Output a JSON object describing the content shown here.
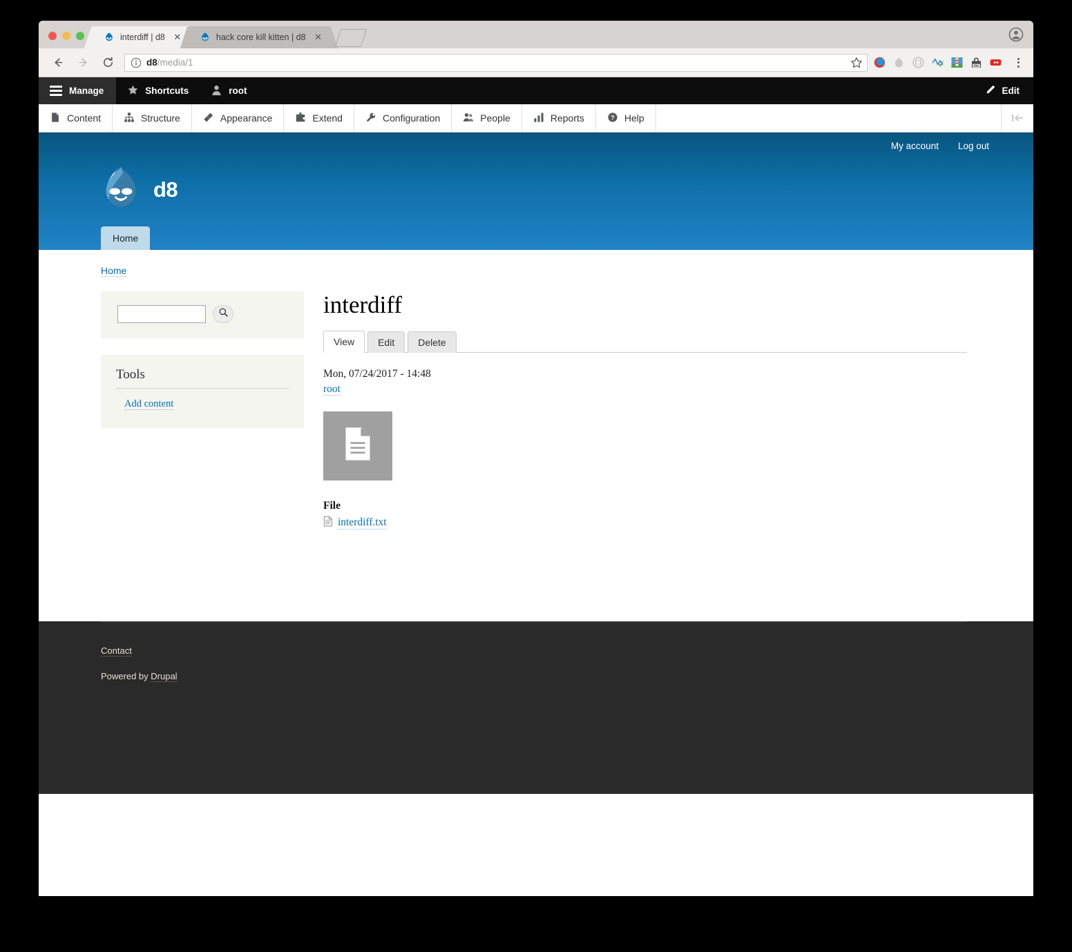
{
  "browser": {
    "tabs": [
      {
        "title": "interdiff | d8",
        "favicon": "drupal-favicon",
        "active": true,
        "close_label": "✕"
      },
      {
        "title": "hack core kill kitten | d8",
        "favicon": "drupal-favicon",
        "active": false,
        "close_label": "✕"
      }
    ],
    "new_tab_label": "",
    "nav": {
      "back": "←",
      "forward": "→",
      "reload": "⟳"
    },
    "url": {
      "host": "d8",
      "path": "/media/1",
      "full": "d8/media/1"
    },
    "extensions": [
      "drupal-dev-icon",
      "drupal-gray-icon",
      "parens-icon",
      "zigzag-check-icon",
      "lighthouse-icon",
      "bag-9m-icon",
      "video-play-icon"
    ],
    "bag_badge": "9m"
  },
  "admin_toolbar": {
    "manage": "Manage",
    "shortcuts": "Shortcuts",
    "user": "root",
    "edit": "Edit",
    "menu": [
      {
        "label": "Content",
        "icon": "content-icon"
      },
      {
        "label": "Structure",
        "icon": "structure-icon"
      },
      {
        "label": "Appearance",
        "icon": "appearance-icon"
      },
      {
        "label": "Extend",
        "icon": "extend-icon"
      },
      {
        "label": "Configuration",
        "icon": "configuration-icon"
      },
      {
        "label": "People",
        "icon": "people-icon"
      },
      {
        "label": "Reports",
        "icon": "reports-icon"
      },
      {
        "label": "Help",
        "icon": "help-icon"
      }
    ]
  },
  "site_header": {
    "site_name": "d8",
    "logo": "drupal-droplet-logo",
    "account_links": [
      {
        "label": "My account"
      },
      {
        "label": "Log out"
      }
    ],
    "primary_tab": "Home",
    "gradient_top": "#08557f",
    "gradient_bottom": "#2083c6"
  },
  "breadcrumb": {
    "items": [
      {
        "label": "Home"
      }
    ]
  },
  "sidebar": {
    "search": {
      "value": "",
      "placeholder": "",
      "submit_icon": "search-icon"
    },
    "tools": {
      "title": "Tools",
      "items": [
        {
          "label": "Add content"
        }
      ]
    }
  },
  "main": {
    "title": "interdiff",
    "tabs": [
      {
        "label": "View",
        "active": true
      },
      {
        "label": "Edit",
        "active": false
      },
      {
        "label": "Delete",
        "active": false
      }
    ],
    "submitted_date": "Mon, 07/24/2017 - 14:48",
    "submitted_author": "root",
    "thumbnail_icon": "document-icon",
    "file_label": "File",
    "file_link": "interdiff.txt",
    "file_icon": "text-file-icon"
  },
  "footer": {
    "contact": "Contact",
    "powered_prefix": "Powered by ",
    "powered_link": "Drupal"
  },
  "colors": {
    "accent_blue": "#0071b3",
    "toolbar_black": "#0d0d0d",
    "footer_dark": "#2a2a2a",
    "thumb_gray": "#a0a0a0"
  }
}
